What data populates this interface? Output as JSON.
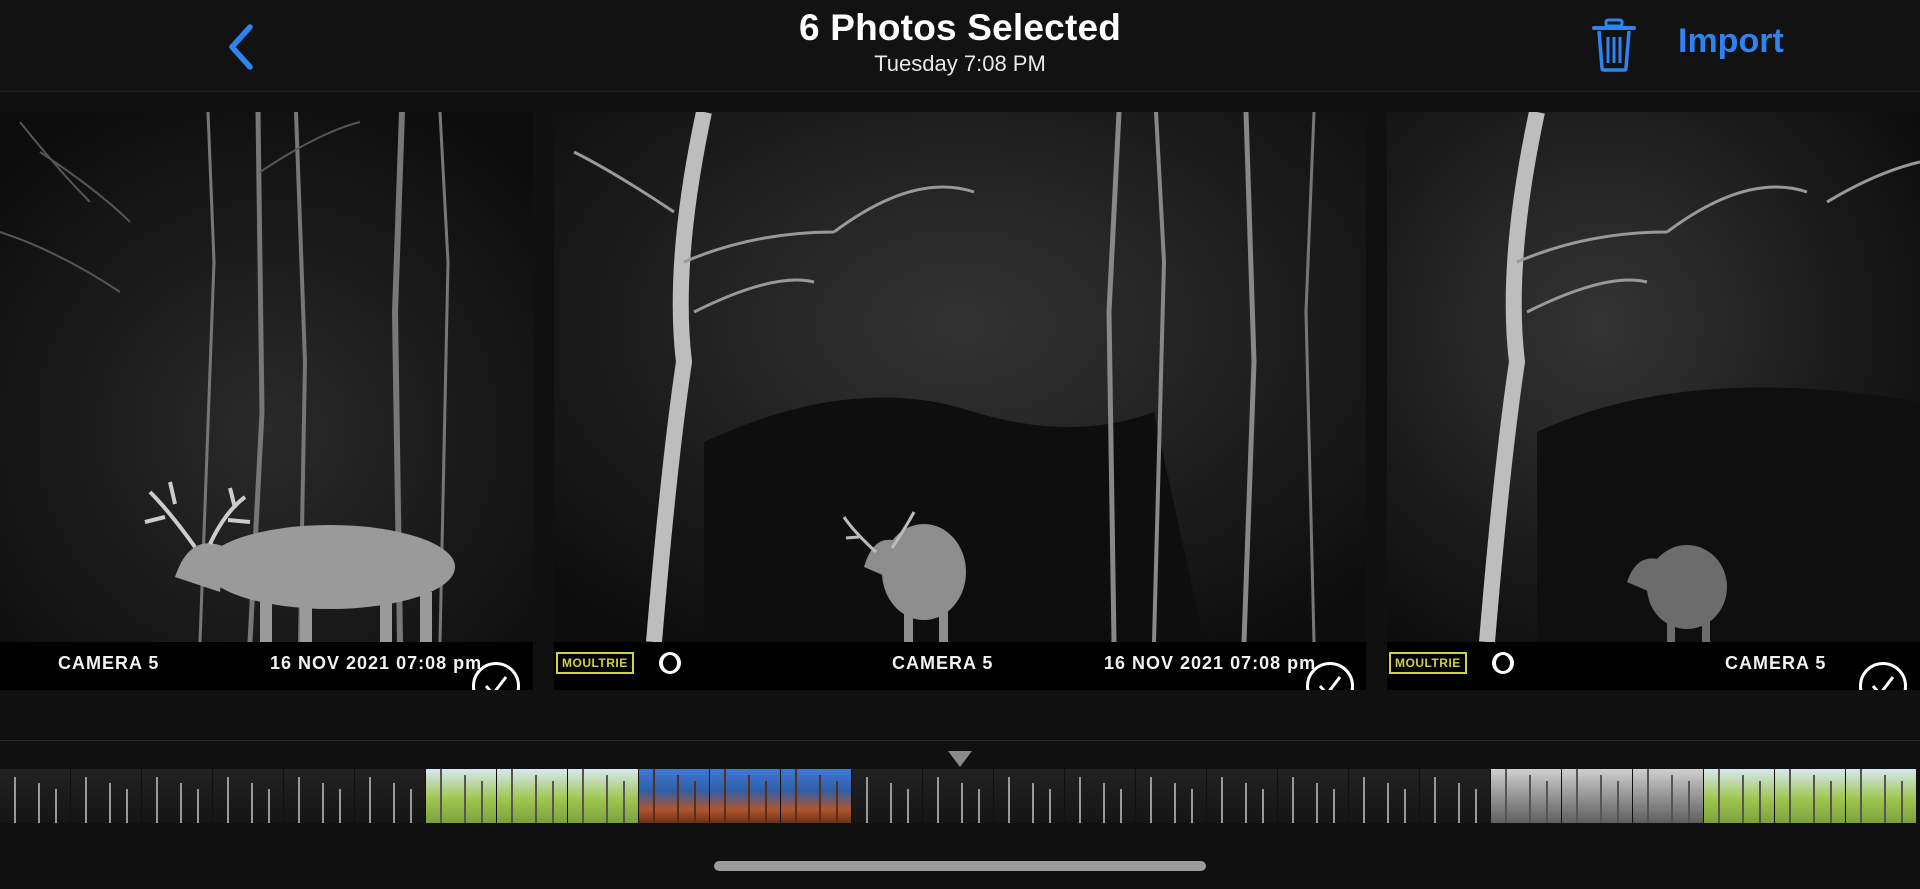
{
  "header": {
    "title": "6 Photos Selected",
    "subtitle": "Tuesday  7:08 PM",
    "import_label": "Import",
    "accent_color": "#2d84f0",
    "back_icon": "chevron-left-icon",
    "trash_icon": "trash-icon"
  },
  "photos": [
    {
      "camera": "CAMERA 5",
      "datetime": "16 NOV 2021  07:08 pm",
      "selected": true
    },
    {
      "brand": "MOULTRIE",
      "camera": "CAMERA 5",
      "datetime": "16 NOV 2021  07:08 pm",
      "selected": true
    },
    {
      "brand": "MOULTRIE",
      "camera": "CAMERA 5",
      "selected": true
    }
  ],
  "filmstrip": {
    "thumbnails": [
      "night",
      "night",
      "night",
      "night",
      "night",
      "night",
      "green",
      "green",
      "green",
      "blue",
      "blue",
      "blue",
      "night",
      "night",
      "night",
      "night",
      "night",
      "night",
      "night",
      "night",
      "night",
      "gray",
      "gray",
      "gray",
      "green",
      "green",
      "green"
    ]
  }
}
